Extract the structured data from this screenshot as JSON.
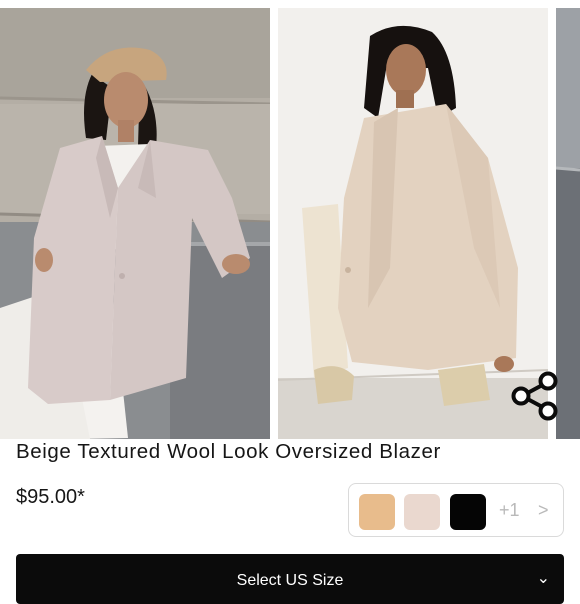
{
  "product": {
    "title": "Beige Textured Wool Look Oversized Blazer",
    "price": "$95.00*"
  },
  "gallery": {
    "images": [
      "photo-model-leaning-wall",
      "photo-model-crouching-back-view",
      "photo-next-partial"
    ]
  },
  "share": {
    "icon": "share-icon"
  },
  "swatches": {
    "colors": [
      "#e8bc8c",
      "#ead8cf",
      "#050505"
    ],
    "more_label": "+1",
    "chevron": ">"
  },
  "select_size": {
    "label": "Select US Size",
    "icon": "chevron-down-icon"
  }
}
